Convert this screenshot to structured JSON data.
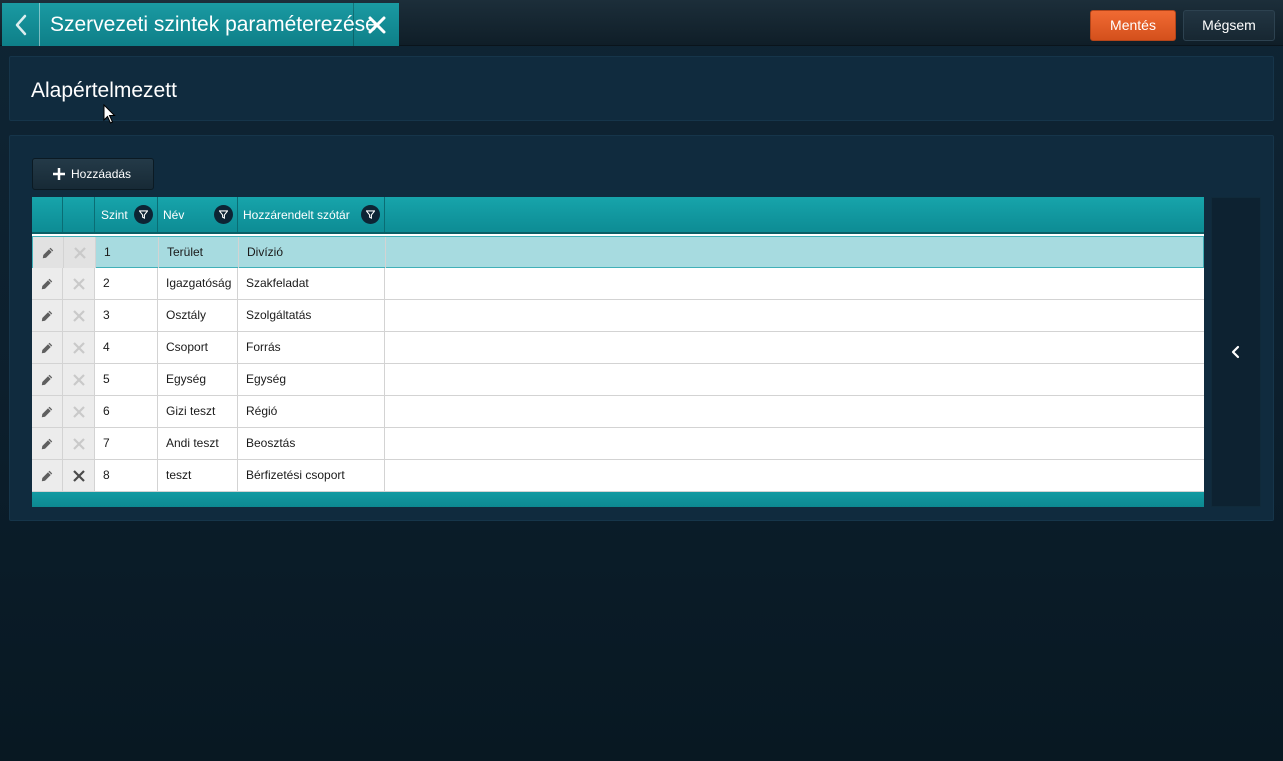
{
  "topbar": {
    "title": "Szervezeti szintek paraméterezése",
    "save_label": "Mentés",
    "cancel_label": "Mégsem",
    "save_color": "#e35a25"
  },
  "header": {
    "title": "Alapértelmezett"
  },
  "content": {
    "add_label": "Hozzáadás"
  },
  "grid": {
    "columns": [
      "Szint",
      "Név",
      "Hozzárendelt szótár"
    ],
    "rows": [
      {
        "level": "1",
        "name": "Terület",
        "dictionary": "Divízió",
        "selected": true,
        "delete_enabled": false
      },
      {
        "level": "2",
        "name": "Igazgatóság",
        "dictionary": "Szakfeladat",
        "selected": false,
        "delete_enabled": false
      },
      {
        "level": "3",
        "name": "Osztály",
        "dictionary": "Szolgáltatás",
        "selected": false,
        "delete_enabled": false
      },
      {
        "level": "4",
        "name": "Csoport",
        "dictionary": "Forrás",
        "selected": false,
        "delete_enabled": false
      },
      {
        "level": "5",
        "name": "Egység",
        "dictionary": "Egység",
        "selected": false,
        "delete_enabled": false
      },
      {
        "level": "6",
        "name": "Gizi teszt",
        "dictionary": "Régió",
        "selected": false,
        "delete_enabled": false
      },
      {
        "level": "7",
        "name": "Andi teszt",
        "dictionary": "Beosztás",
        "selected": false,
        "delete_enabled": false
      },
      {
        "level": "8",
        "name": "teszt",
        "dictionary": "Bérfizetési csoport",
        "selected": false,
        "delete_enabled": true
      }
    ]
  },
  "icons": {
    "back": "chevron-left-icon",
    "close": "close-icon",
    "add": "plus-icon",
    "filter": "filter-icon",
    "edit": "pencil-icon",
    "delete": "x-icon",
    "collapse": "chevron-left-icon"
  }
}
